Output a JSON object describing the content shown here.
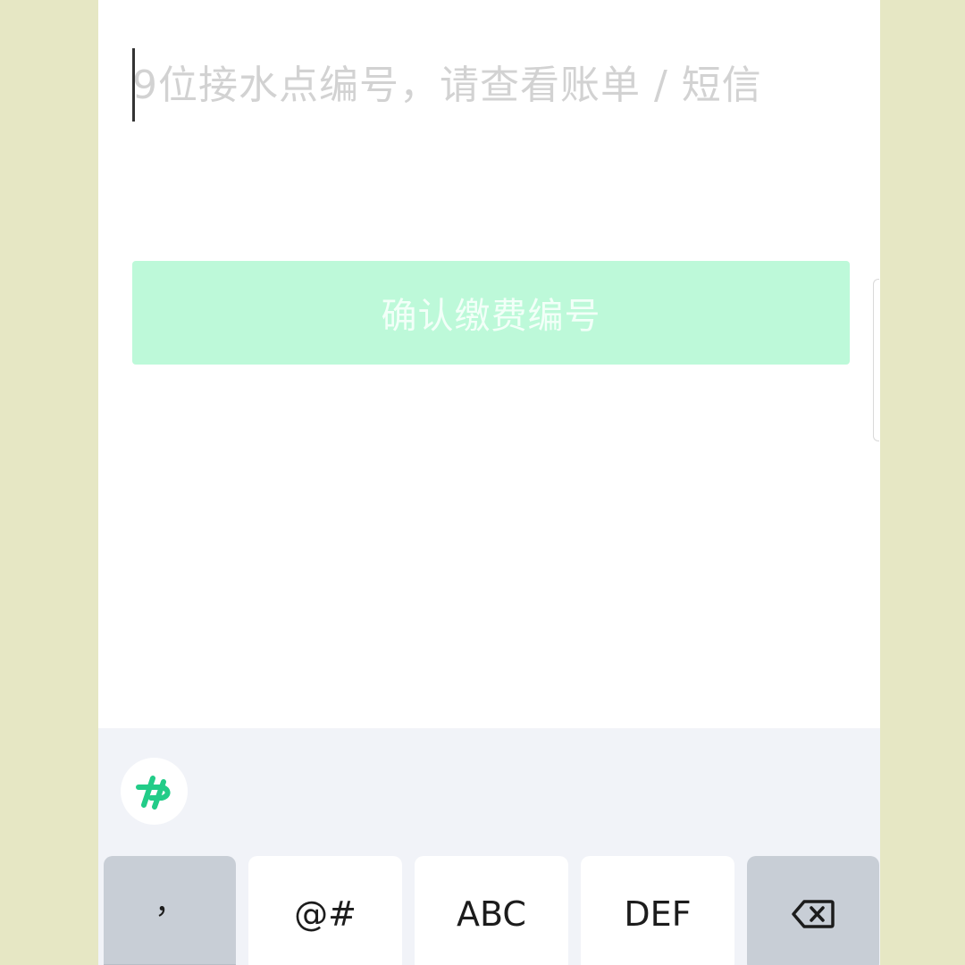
{
  "input": {
    "placeholder": "9位接水点编号，请查看账单 / 短信"
  },
  "confirm_button": {
    "label": "确认缴费编号"
  },
  "keyboard": {
    "logo_icon": "keyboard-app-logo-icon",
    "keys": {
      "comma": "，",
      "symbols": "@#",
      "abc": "ABC",
      "def": "DEF",
      "delete_icon": "backspace-icon"
    }
  },
  "colors": {
    "background": "#e6e7c4",
    "button_bg": "#bdf9d9",
    "brand_green": "#22cc88",
    "keyboard_bg": "#f1f3f8",
    "dark_key": "#c8ced6"
  }
}
